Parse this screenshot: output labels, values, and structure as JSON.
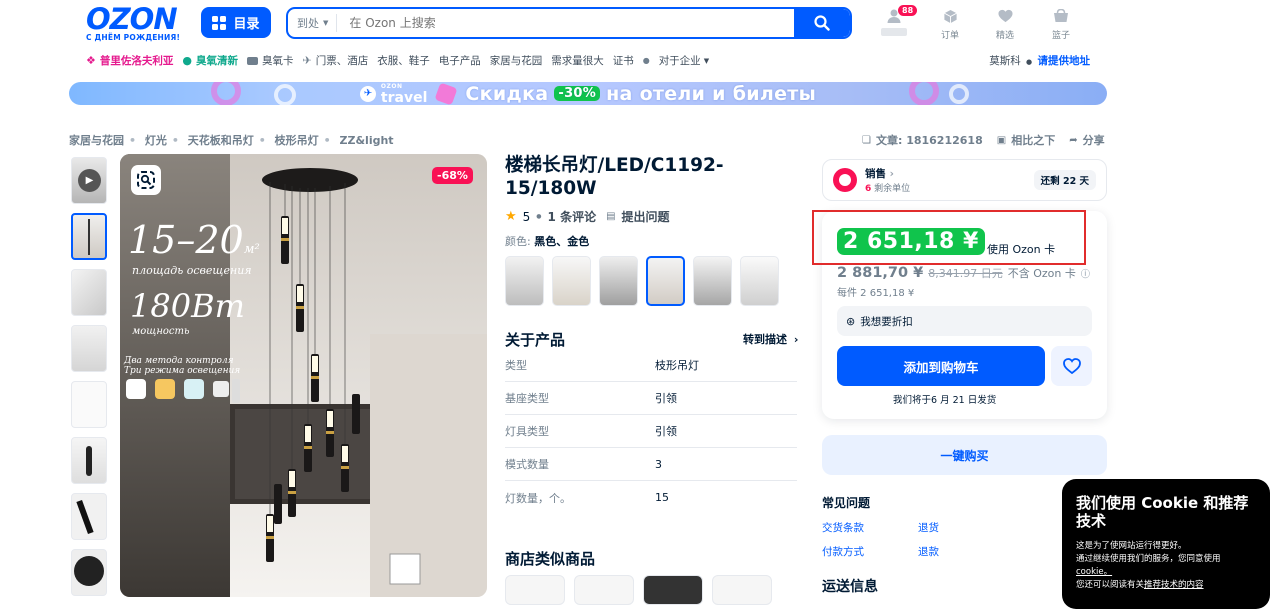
{
  "header": {
    "logo_word": "OZON",
    "logo_sub": "С ДНЁМ РОЖДЕНИЯ!",
    "catalog_label": "目录",
    "search_where": "到处",
    "search_placeholder": "在 Ozon 上搜索",
    "profile_badge": "88",
    "icons": [
      {
        "label": "",
        "icon": "user-icon"
      },
      {
        "label": "订单",
        "icon": "box-icon"
      },
      {
        "label": "精选",
        "icon": "heart-icon"
      },
      {
        "label": "篮子",
        "icon": "cart-icon"
      }
    ]
  },
  "nav": {
    "items": [
      "普里佐洛夫利亚",
      "臭氧清新",
      "臭氧卡",
      "门票、酒店",
      "衣服、鞋子",
      "电子产品",
      "家居与花园",
      "需求量很大",
      "证书",
      "对于企业"
    ],
    "city": "莫斯科",
    "address_link": "请提供地址"
  },
  "banner": {
    "brand_top": "OZON",
    "brand": "travel",
    "text_before": "Скидка",
    "percent": "-30%",
    "text_after": "на отели и билеты"
  },
  "breadcrumbs": [
    "家居与花园",
    "灯光",
    "天花板和吊灯",
    "枝形吊灯",
    "ZZ&light"
  ],
  "meta": {
    "article": "文章: 1816212618",
    "compare": "相比之下",
    "share": "分享"
  },
  "gallery": {
    "discount": "-68%",
    "promo_big": "15–20",
    "promo_unit": "м²",
    "promo_line": "площадь освещения",
    "promo_watt": "180Вт",
    "promo_watt_sub": "мощность",
    "promo_modes": "Два метода контроля",
    "promo_modes2": "Три режима освещения"
  },
  "product": {
    "title": "楼梯长吊灯/LED/C1192-15/180W",
    "rating": "5",
    "reviews": "1 条评论",
    "ask": "提出问题",
    "color_label": "颜色:",
    "color_value": "黑色、金色",
    "about": "关于产品",
    "goto_desc": "转到描述",
    "specs": [
      {
        "k": "类型",
        "v": "枝形吊灯"
      },
      {
        "k": "基座类型",
        "v": "引领"
      },
      {
        "k": "灯具类型",
        "v": "引领"
      },
      {
        "k": "模式数量",
        "v": "3"
      },
      {
        "k": "灯数量，个。",
        "v": "15"
      }
    ],
    "similar": "商店类似商品"
  },
  "seller": {
    "name": "销售",
    "count_num": "6",
    "count_text": "剩余单位",
    "left": "还剩 22 天"
  },
  "price": {
    "card_price": "2 651,18 ¥",
    "card_label": "使用 Ozon 卡",
    "price": "2 881,70 ¥",
    "old_price": "8,341.97 日元",
    "no_card": "不含 Ozon 卡",
    "per_unit": "每件 2 651,18 ¥",
    "bargain": "我想要折扣",
    "add_to_cart": "添加到购物车",
    "ship": "我们将于6 月 21 日发货",
    "one_click": "一键购买"
  },
  "faq": {
    "title": "常见问题",
    "links": [
      "交货条款",
      "退货",
      "付款方式",
      "退款"
    ]
  },
  "delivery_title": "运送信息",
  "cookie": {
    "title": "我们使用 Cookie 和推荐技术",
    "p1": "这是为了使网站运行得更好。",
    "p2": "通过继续使用我们的服务，您同意使用",
    "p2_link": "cookie。",
    "p3": "您还可以阅读有关",
    "p3_link": "推荐技术的内容"
  },
  "colors": {
    "brand": "#005bff",
    "accent_pink": "#f91155",
    "green_price": "#10c44c",
    "highlight_red": "#e12c2c"
  }
}
